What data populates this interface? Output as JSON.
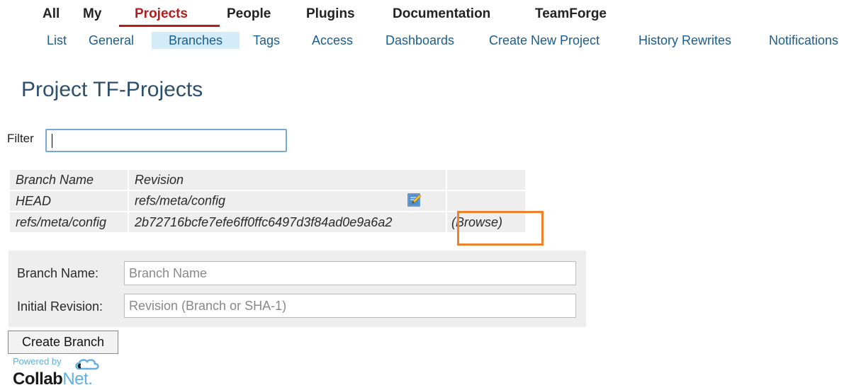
{
  "top_nav": {
    "items": [
      "All",
      "My",
      "Projects",
      "People",
      "Plugins",
      "Documentation",
      "TeamForge"
    ],
    "active": "Projects"
  },
  "sub_nav": {
    "items": [
      "List",
      "General",
      "Branches",
      "Tags",
      "Access",
      "Dashboards",
      "Create New Project",
      "History Rewrites",
      "Notifications"
    ],
    "active": "Branches"
  },
  "page": {
    "title": "Project TF-Projects"
  },
  "filter": {
    "label": "Filter",
    "value": ""
  },
  "branches": {
    "headers": {
      "name": "Branch Name",
      "revision": "Revision"
    },
    "rows": [
      {
        "name": "HEAD",
        "revision": "refs/meta/config",
        "browse": ""
      },
      {
        "name": "refs/meta/config",
        "revision": "2b72716bcfe7efe6ff0ffc6497d3f84ad0e9a6a2",
        "browse": "(Browse)"
      }
    ]
  },
  "create_form": {
    "branch_name_label": "Branch Name:",
    "branch_name_placeholder": "Branch Name",
    "initial_revision_label": "Initial Revision:",
    "initial_revision_placeholder": "Revision (Branch or SHA-1)",
    "button_label": "Create Branch"
  },
  "footer": {
    "powered_by": "Powered by",
    "brand_collab": "Collab",
    "brand_net": "Net."
  },
  "colors": {
    "active_nav": "#b71c1c",
    "link": "#1a5d8f",
    "highlight": "#f0812c",
    "subnav_active_bg": "#d4ecfa"
  }
}
